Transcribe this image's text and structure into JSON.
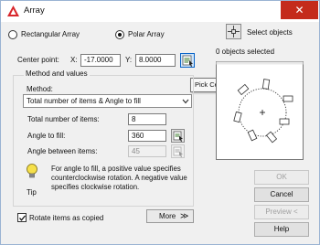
{
  "window": {
    "title": "Array",
    "close_glyph": "✕"
  },
  "array_type": {
    "rectangular_label": "Rectangular Array",
    "polar_label": "Polar Array",
    "selected": "polar"
  },
  "center_point": {
    "label": "Center point:",
    "x_label": "X:",
    "x_value": "-17.0000",
    "y_label": "Y:",
    "y_value": "8.0000"
  },
  "tooltip": {
    "text": "Pick Center Point"
  },
  "method_group": {
    "title": "Method and values",
    "method_label": "Method:",
    "method_value": "Total number of items & Angle to fill",
    "total_items_label": "Total number of items:",
    "total_items_value": "8",
    "angle_fill_label": "Angle to fill:",
    "angle_fill_value": "360",
    "angle_between_label": "Angle between items:",
    "angle_between_value": "45"
  },
  "tip": {
    "label": "Tip",
    "text": "For angle to fill, a positive value specifies counterclockwise rotation.  A negative value specifies clockwise rotation."
  },
  "rotate_items": {
    "label": "Rotate items as copied",
    "checked": true
  },
  "more_button": {
    "label": "More",
    "glyph": "≫"
  },
  "select_objects": {
    "label": "Select objects",
    "status": "0 objects selected"
  },
  "buttons": {
    "ok": "OK",
    "cancel": "Cancel",
    "preview": "Preview <",
    "help": "Help"
  },
  "colors": {
    "close": "#c42b1c",
    "focus_blue": "#0a64c8",
    "title_icon": "#d8262b"
  },
  "icons": {
    "title": "autocad-array-icon",
    "select_objects": "crosshair-icon",
    "pick_point": "pick-point-icon",
    "tip": "lightbulb-icon"
  }
}
